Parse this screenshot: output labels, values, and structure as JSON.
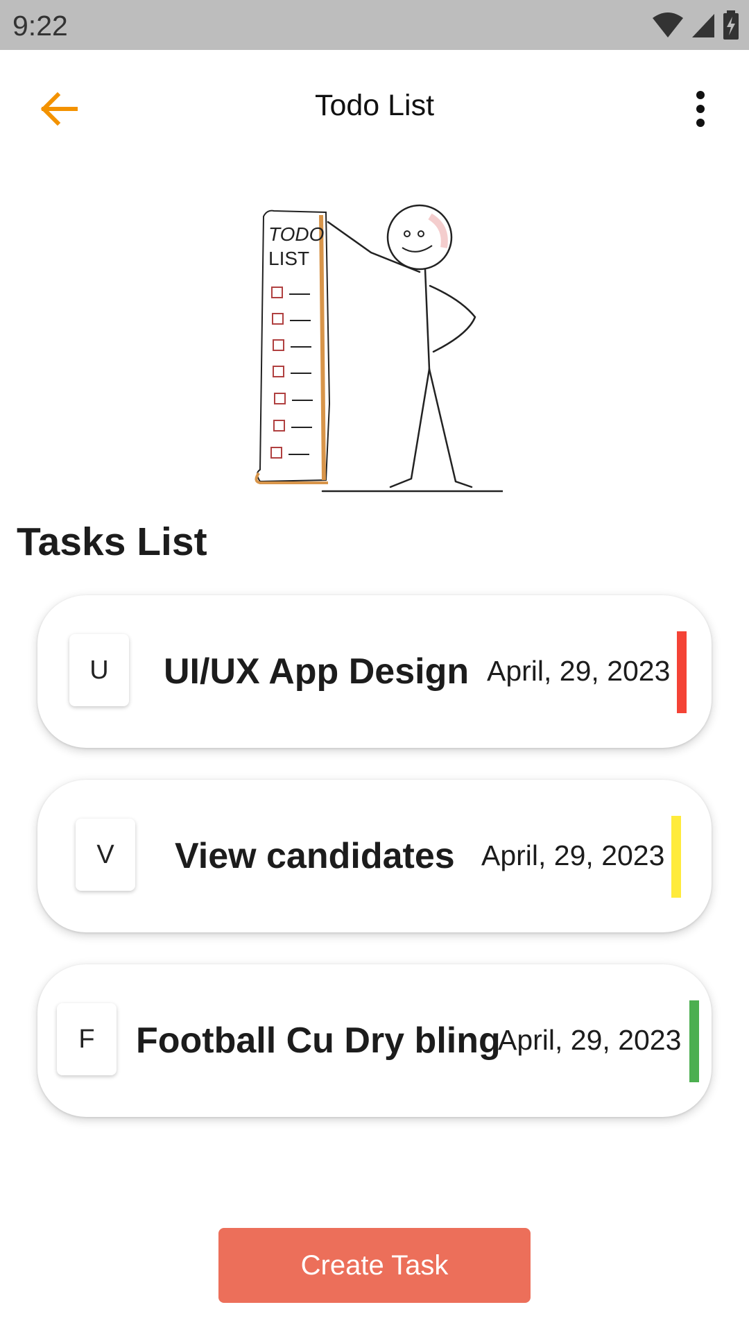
{
  "status_bar": {
    "time": "9:22",
    "icons": [
      "wifi-icon",
      "signal-icon",
      "battery-charging-icon"
    ]
  },
  "app_bar": {
    "title": "Todo List",
    "back_icon": "arrow-left-icon",
    "menu_icon": "more-vert-icon",
    "accent_color": "#f39200"
  },
  "illustration": {
    "scroll_text_line1": "TODO",
    "scroll_text_line2": "LIST"
  },
  "section": {
    "title": "Tasks List"
  },
  "tasks": [
    {
      "letter": "U",
      "name": "UI/UX App Design",
      "date": "April, 29, 2023",
      "priority_color": "#f44336"
    },
    {
      "letter": "V",
      "name": "View candidates",
      "date": "April, 29, 2023",
      "priority_color": "#ffeb3b"
    },
    {
      "letter": "F",
      "name": "Football Cu Dry bling",
      "date": "April, 29, 2023",
      "priority_color": "#4caf50"
    }
  ],
  "actions": {
    "create_label": "Create Task",
    "create_color": "#ec6f5a"
  }
}
